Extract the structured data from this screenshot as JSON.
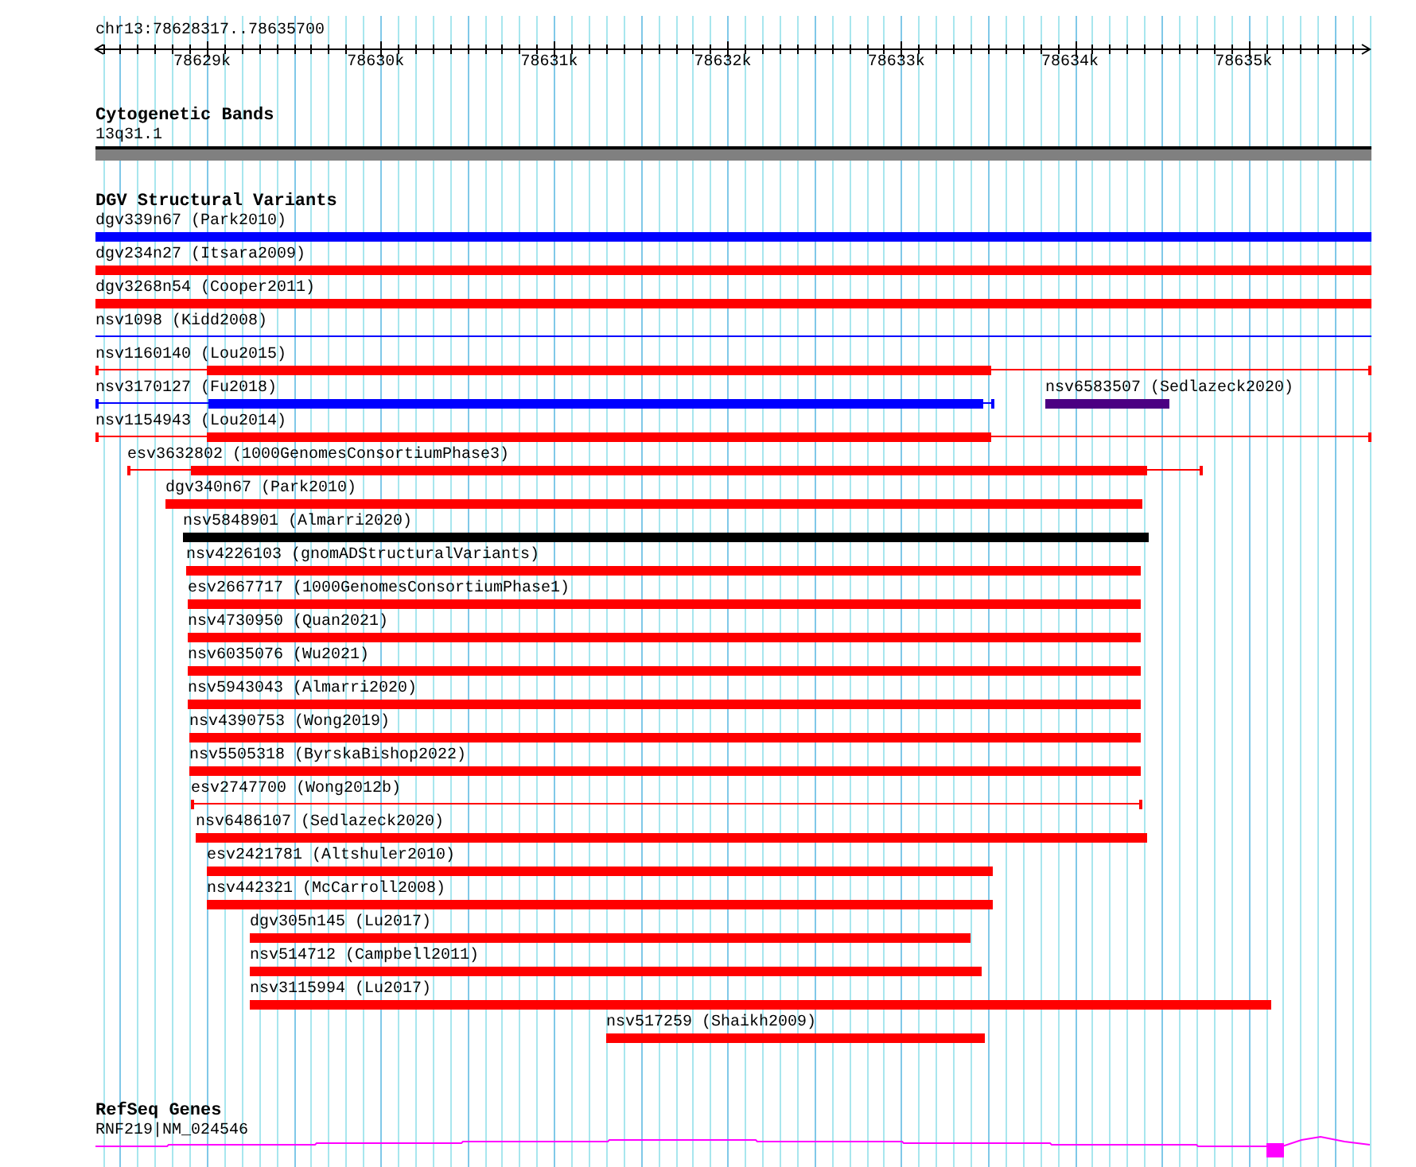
{
  "location": "chr13:78628317..78635700",
  "ruler": {
    "tick_labels": [
      "78629k",
      "78630k",
      "78631k",
      "78632k",
      "78633k",
      "78634k",
      "78635k"
    ]
  },
  "cytoband_track": {
    "title": "Cytogenetic Bands",
    "band_label": "13q31.1"
  },
  "variant_track": {
    "title": "DGV Structural Variants",
    "features": [
      {
        "label": "dgv339n67 (Park2010)",
        "color": "#0000ff",
        "kind": "thick"
      },
      {
        "label": "dgv234n27 (Itsara2009)",
        "color": "#ff0000",
        "kind": "thick"
      },
      {
        "label": "dgv3268n54 (Cooper2011)",
        "color": "#ff0000",
        "kind": "thick"
      },
      {
        "label": "nsv1098 (Kidd2008)",
        "color": "#0000ff",
        "kind": "line"
      },
      {
        "label": "nsv1160140 (Lou2015)",
        "color": "#ff0000",
        "kind": "split"
      },
      {
        "label": "nsv3170127 (Fu2018)",
        "color": "#0000ff",
        "kind": "split"
      },
      {
        "label": "nsv6583507 (Sedlazeck2020)",
        "color": "#4b0082",
        "kind": "thick"
      },
      {
        "label": "nsv1154943 (Lou2014)",
        "color": "#ff0000",
        "kind": "split"
      },
      {
        "label": "esv3632802 (1000GenomesConsortiumPhase3)",
        "color": "#ff0000",
        "kind": "split"
      },
      {
        "label": "dgv340n67 (Park2010)",
        "color": "#ff0000",
        "kind": "thick"
      },
      {
        "label": "nsv5848901 (Almarri2020)",
        "color": "#000000",
        "kind": "thick"
      },
      {
        "label": "nsv4226103 (gnomADStructuralVariants)",
        "color": "#ff0000",
        "kind": "thick"
      },
      {
        "label": "esv2667717 (1000GenomesConsortiumPhase1)",
        "color": "#ff0000",
        "kind": "thick"
      },
      {
        "label": "nsv4730950 (Quan2021)",
        "color": "#ff0000",
        "kind": "thick"
      },
      {
        "label": "nsv6035076 (Wu2021)",
        "color": "#ff0000",
        "kind": "thick"
      },
      {
        "label": "nsv5943043 (Almarri2020)",
        "color": "#ff0000",
        "kind": "thick"
      },
      {
        "label": "nsv4390753 (Wong2019)",
        "color": "#ff0000",
        "kind": "thick"
      },
      {
        "label": "nsv5505318 (ByrskaBishop2022)",
        "color": "#ff0000",
        "kind": "thick"
      },
      {
        "label": "esv2747700 (Wong2012b)",
        "color": "#ff0000",
        "kind": "line"
      },
      {
        "label": "nsv6486107 (Sedlazeck2020)",
        "color": "#ff0000",
        "kind": "thick"
      },
      {
        "label": "esv2421781 (Altshuler2010)",
        "color": "#ff0000",
        "kind": "thick"
      },
      {
        "label": "nsv442321 (McCarroll2008)",
        "color": "#ff0000",
        "kind": "thick"
      },
      {
        "label": "dgv305n145 (Lu2017)",
        "color": "#ff0000",
        "kind": "thick"
      },
      {
        "label": "nsv514712 (Campbell2011)",
        "color": "#ff0000",
        "kind": "thick"
      },
      {
        "label": "nsv3115994 (Lu2017)",
        "color": "#ff0000",
        "kind": "thick"
      },
      {
        "label": "nsv517259 (Shaikh2009)",
        "color": "#ff0000",
        "kind": "thick"
      }
    ]
  },
  "gene_track": {
    "title": "RefSeq Genes",
    "gene_label": "RNF219|NM_024546"
  }
}
